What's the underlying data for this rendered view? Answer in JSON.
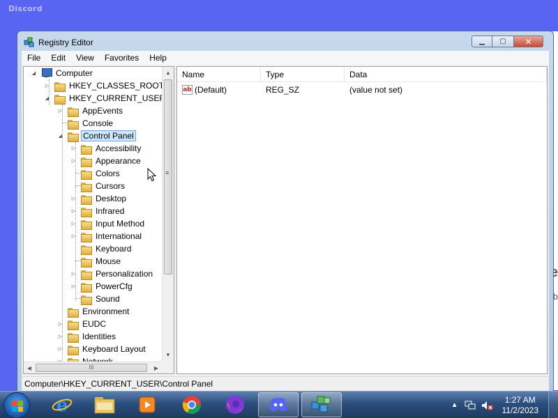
{
  "background": {
    "app_title": "Discord"
  },
  "window": {
    "title": "Registry Editor",
    "caption": {
      "minimize": "▁",
      "maximize": "▢",
      "close": "✕"
    }
  },
  "menu": [
    "File",
    "Edit",
    "View",
    "Favorites",
    "Help"
  ],
  "tree": {
    "root": "Computer",
    "hives": [
      "HKEY_CLASSES_ROOT",
      "HKEY_CURRENT_USER"
    ],
    "current_user_children": [
      "AppEvents",
      "Console",
      "Control Panel"
    ],
    "control_panel_children": [
      "Accessibility",
      "Appearance",
      "Colors",
      "Cursors",
      "Desktop",
      "Infrared",
      "Input Method",
      "International",
      "Keyboard",
      "Mouse",
      "Personalization",
      "PowerCfg",
      "Sound"
    ],
    "more_children": [
      "Environment",
      "EUDC",
      "Identities",
      "Keyboard Layout",
      "Network"
    ],
    "selected": "Control Panel",
    "hscroll_grip": "III",
    "vscroll_grip": "≡"
  },
  "list": {
    "columns": [
      "Name",
      "Type",
      "Data"
    ],
    "rows": [
      {
        "name": "(Default)",
        "type": "REG_SZ",
        "data": "(value not set)"
      }
    ]
  },
  "status_path": "Computer\\HKEY_CURRENT_USER\\Control Panel",
  "taskbar": {
    "clock_time": "1:27 AM",
    "clock_date": "11/2/2023",
    "apps": [
      "internet-explorer",
      "file-explorer",
      "media-player",
      "chrome",
      "firefox",
      "discord",
      "registry-editor"
    ],
    "active_apps": [
      "discord",
      "registry-editor"
    ]
  }
}
